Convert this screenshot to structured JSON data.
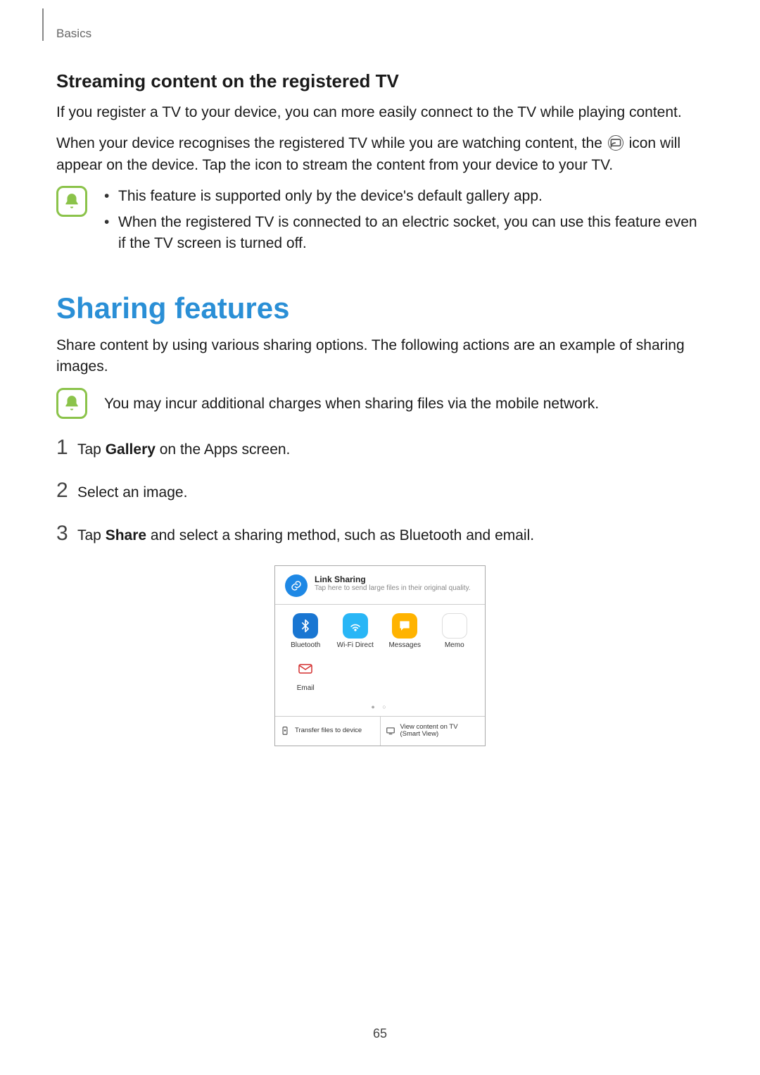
{
  "header": {
    "section": "Basics"
  },
  "section1": {
    "subheading": "Streaming content on the registered TV",
    "para1": "If you register a TV to your device, you can more easily connect to the TV while playing content.",
    "para2a": "When your device recognises the registered TV while you are watching content, the ",
    "para2b": " icon will appear on the device. Tap the icon to stream the content from your device to your TV.",
    "notes": [
      "This feature is supported only by the device's default gallery app.",
      "When the registered TV is connected to an electric socket, you can use this feature even if the TV screen is turned off."
    ]
  },
  "section2": {
    "heading": "Sharing features",
    "intro": "Share content by using various sharing options. The following actions are an example of sharing images.",
    "note": "You may incur additional charges when sharing files via the mobile network.",
    "steps": [
      {
        "num": "1",
        "pre": "Tap ",
        "bold": "Gallery",
        "post": " on the Apps screen."
      },
      {
        "num": "2",
        "pre": "Select an image.",
        "bold": "",
        "post": ""
      },
      {
        "num": "3",
        "pre": "Tap ",
        "bold": "Share",
        "post": " and select a sharing method, such as Bluetooth and email."
      }
    ],
    "share_panel": {
      "link_title": "Link Sharing",
      "link_sub": "Tap here to send large files in their original quality.",
      "items": [
        {
          "key": "bluetooth",
          "label": "Bluetooth"
        },
        {
          "key": "wifidirect",
          "label": "Wi-Fi Direct"
        },
        {
          "key": "messages",
          "label": "Messages"
        },
        {
          "key": "memo",
          "label": "Memo"
        },
        {
          "key": "email",
          "label": "Email"
        }
      ],
      "bottom_left": "Transfer files to device",
      "bottom_right_line1": "View content on TV",
      "bottom_right_line2": "(Smart View)"
    }
  },
  "page_number": "65"
}
